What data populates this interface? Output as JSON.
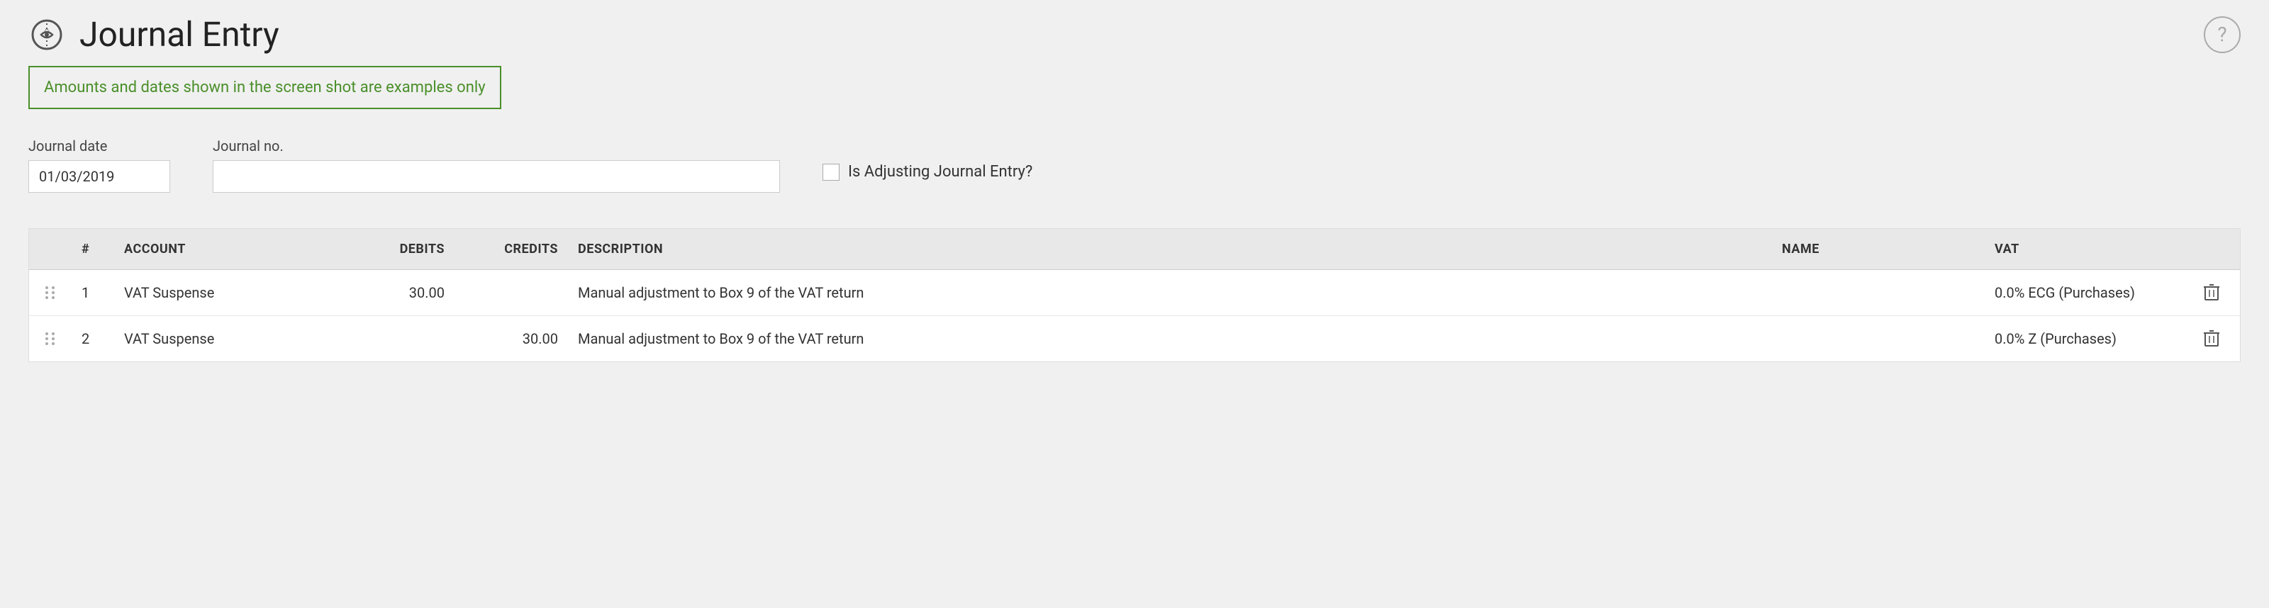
{
  "page": {
    "title": "Journal Entry",
    "icon_label": "journal-icon"
  },
  "help": {
    "label": "?"
  },
  "notice": {
    "text": "Amounts and dates shown in the screen shot are examples only"
  },
  "form": {
    "journal_date_label": "Journal date",
    "journal_date_value": "01/03/2019",
    "journal_no_label": "Journal no.",
    "journal_no_value": "",
    "is_adjusting_label": "Is Adjusting Journal Entry?"
  },
  "table": {
    "columns": [
      {
        "key": "drag",
        "label": ""
      },
      {
        "key": "num",
        "label": "#"
      },
      {
        "key": "account",
        "label": "ACCOUNT"
      },
      {
        "key": "debits",
        "label": "DEBITS",
        "align": "right"
      },
      {
        "key": "credits",
        "label": "CREDITS",
        "align": "right"
      },
      {
        "key": "description",
        "label": "DESCRIPTION"
      },
      {
        "key": "name",
        "label": "NAME"
      },
      {
        "key": "vat",
        "label": "VAT"
      },
      {
        "key": "action",
        "label": ""
      }
    ],
    "rows": [
      {
        "num": "1",
        "account": "VAT Suspense",
        "debits": "30.00",
        "credits": "",
        "description": "Manual adjustment to Box 9 of the VAT return",
        "name": "",
        "vat": "0.0% ECG (Purchases)"
      },
      {
        "num": "2",
        "account": "VAT Suspense",
        "debits": "",
        "credits": "30.00",
        "description": "Manual adjustment to Box 9 of the VAT return",
        "name": "",
        "vat": "0.0% Z (Purchases)"
      }
    ]
  }
}
